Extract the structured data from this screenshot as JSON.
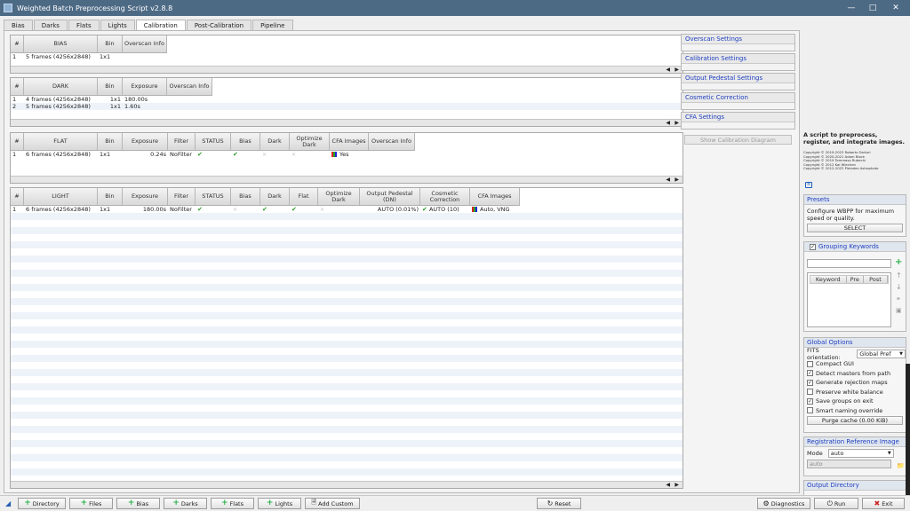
{
  "window": {
    "title": "Weighted Batch Preprocessing Script v2.8.8"
  },
  "tabs": [
    "Bias",
    "Darks",
    "Flats",
    "Lights",
    "Calibration",
    "Post-Calibration",
    "Pipeline"
  ],
  "bias": {
    "headers": [
      "#",
      "BIAS",
      "Bin",
      "Overscan Info"
    ],
    "rows": [
      [
        "1",
        "5 frames (4256x2848)",
        "1x1",
        ""
      ]
    ]
  },
  "dark": {
    "headers": [
      "#",
      "DARK",
      "Bin",
      "Exposure",
      "Overscan Info"
    ],
    "rows": [
      [
        "1",
        "4 frames (4256x2848)",
        "1x1",
        "180.00s",
        ""
      ],
      [
        "2",
        "5 frames (4256x2848)",
        "1x1",
        "1.60s",
        ""
      ]
    ]
  },
  "flat": {
    "headers": [
      "#",
      "FLAT",
      "Bin",
      "Exposure",
      "Filter",
      "STATUS",
      "Bias",
      "Dark",
      "Optimize Dark",
      "CFA Images",
      "Overscan Info"
    ],
    "row": {
      "n": "1",
      "name": "6 frames (4256x2848)",
      "bin": "1x1",
      "exposure": "0.24s",
      "filter": "NoFilter",
      "cfa": "Yes"
    }
  },
  "light": {
    "headers": [
      "#",
      "LIGHT",
      "Bin",
      "Exposure",
      "Filter",
      "STATUS",
      "Bias",
      "Dark",
      "Flat",
      "Optimize Dark",
      "Output Pedestal (DN)",
      "Cosmetic Correction",
      "CFA Images"
    ],
    "row": {
      "n": "1",
      "name": "6 frames (4256x2848)",
      "bin": "1x1",
      "exposure": "180.00s",
      "filter": "NoFilter",
      "pedestal": "AUTO (0.01%)",
      "cosmetic": "AUTO (10)",
      "cfa": "Auto, VNG"
    }
  },
  "right_panels": [
    "Overscan Settings",
    "Calibration Settings",
    "Output Pedestal Settings",
    "Cosmetic Correction",
    "CFA Settings"
  ],
  "show_diagram": "Show Calibration Diagram",
  "sidebar": {
    "description": "A script to preprocess, register, and integrate images.",
    "copyright": [
      "Copyright © 2019-2023 Roberto Sartori",
      "Copyright © 2020-2021 Adam Block",
      "Copyright © 2019 Tommaso Rubechi",
      "Copyright © 2012 Kai Wiechen",
      "Copyright © 2012-2023 Pleiades Astrophoto"
    ],
    "presets": {
      "title": "Presets",
      "text": "Configure WBPP for maximum speed or quality.",
      "button": "SELECT"
    },
    "grouping": {
      "title": "Grouping Keywords",
      "cols": [
        "Keyword",
        "Pre",
        "Post"
      ]
    },
    "global": {
      "title": "Global Options",
      "fits_label": "FITS orientation:",
      "fits_value": "Global Pref",
      "checks": [
        {
          "label": "Compact GUI",
          "checked": false
        },
        {
          "label": "Detect masters from path",
          "checked": true
        },
        {
          "label": "Generate rejection maps",
          "checked": true
        },
        {
          "label": "Preserve white balance",
          "checked": false
        },
        {
          "label": "Save groups on exit",
          "checked": true
        },
        {
          "label": "Smart naming override",
          "checked": false
        }
      ],
      "purge": "Purge cache (0.00 KiB)"
    },
    "registration": {
      "title": "Registration Reference Image",
      "mode_label": "Mode",
      "mode_value": "auto",
      "field": "auto"
    },
    "output": {
      "title": "Output Directory"
    }
  },
  "bottom": {
    "buttons": [
      "Directory",
      "Files",
      "Bias",
      "Darks",
      "Flats",
      "Lights",
      "Add Custom"
    ],
    "reset": "Reset",
    "diagnostics": "Diagnostics",
    "run": "Run",
    "exit": "Exit"
  }
}
